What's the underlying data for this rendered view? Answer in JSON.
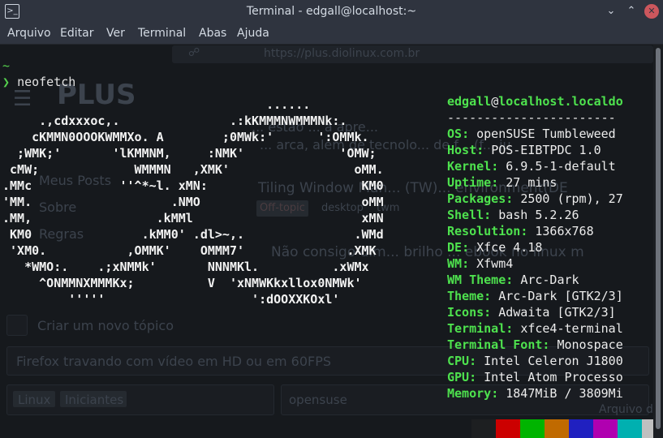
{
  "window": {
    "title": "Terminal - edgall@localhost:~",
    "icons": {
      "app": "terminal-icon",
      "minimize": "chevron-down-icon",
      "maximize": "chevron-up-icon",
      "close": "close-icon"
    }
  },
  "menu": [
    "Arquivo",
    "Editar",
    "Ver",
    "Terminal",
    "Abas",
    "Ajuda"
  ],
  "prompt": {
    "line1": "~",
    "symbol": "❯",
    "command": "neofetch"
  },
  "logo": [
    "                                    ......",
    "     .,cdxxxoc,.               .:kKMMMNWMMMNk:.",
    "    cKMMN0OOOKWMMXo. A        ;0MWk:'      ':OMMk.",
    "  ;WMK;'       'lKMMNM,     :NMK'             'OMW;",
    " cMW;             WMMMN   ,XMK'                 oMM.",
    ".MMc            ''^*~l. xMN:                     KM0",
    "'MM.                   .NMO                      oMM",
    ".MM,                 .kMMl                       xMN",
    " KM0               .kMM0' .dl>~,.               .WMd",
    " 'XM0.           ,OMMK'    OMMM7'              .XMK",
    "   *WMO:.    .;xNMMk'       NNNMKl.          .xWMx",
    "     ^ONMMNXMMMKx;          V  'xNMWKkxllox0NMWk'",
    "         '''''                    ':dOOXXKOxl'"
  ],
  "info": {
    "user": "edgall",
    "at": "@",
    "host": "localhost.localdo",
    "separator": "-----------------------",
    "rows": [
      {
        "key": "OS",
        "value": "openSUSE Tumbleweed"
      },
      {
        "key": "Host",
        "value": "POS-EIBTPDC 1.0"
      },
      {
        "key": "Kernel",
        "value": "6.9.5-1-default"
      },
      {
        "key": "Uptime",
        "value": "27 mins"
      },
      {
        "key": "Packages",
        "value": "2500 (rpm), 27"
      },
      {
        "key": "Shell",
        "value": "bash 5.2.26"
      },
      {
        "key": "Resolution",
        "value": "1366x768"
      },
      {
        "key": "DE",
        "value": "Xfce 4.18"
      },
      {
        "key": "WM",
        "value": "Xfwm4"
      },
      {
        "key": "WM Theme",
        "value": "Arc-Dark"
      },
      {
        "key": "Theme",
        "value": "Arc-Dark [GTK2/3]"
      },
      {
        "key": "Icons",
        "value": "Adwaita [GTK2/3]"
      },
      {
        "key": "Terminal",
        "value": "xfce4-terminal"
      },
      {
        "key": "Terminal Font",
        "value": "Monospace"
      },
      {
        "key": "CPU",
        "value": "Intel Celeron J1800"
      },
      {
        "key": "GPU",
        "value": "Intel Atom Processo"
      },
      {
        "key": "Memory",
        "value": "1847MiB / 3809Mi"
      }
    ]
  },
  "palette": [
    "#1d1f21",
    "#cc0000",
    "#00b400",
    "#c06a00",
    "#2020c0",
    "#b000b0",
    "#00b0b0",
    "#c0c0c0"
  ],
  "background": {
    "url": "https://plus.diolinux.com.br",
    "logo": "PLUS",
    "sidebar": [
      "Meus Posts",
      "Sobre",
      "Regras"
    ],
    "post_title": "Tiling Window Man... (TW)... environment(DE",
    "tags": [
      "Off-topic",
      "desktop",
      "twm"
    ],
    "body_line1": "... estão ... a apre...",
    "body_line2": "... arca, além de tecnolo... de f... (f... ju",
    "post2_title": "Não consigo dim... brilho ... ebook no linux m",
    "new_topic": "Criar um novo tópico",
    "topic_input": "Firefox travando com vídeo em HD ou em 60FPS",
    "categories": [
      "Linux",
      "Iniciantes"
    ],
    "tag_input": "opensuse",
    "attach": "Arquivo de"
  }
}
